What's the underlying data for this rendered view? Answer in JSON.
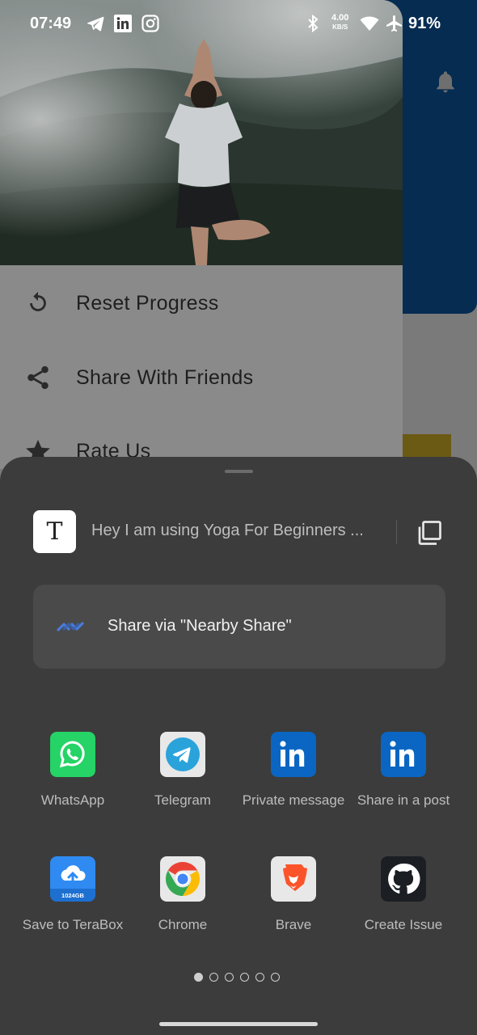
{
  "status_bar": {
    "time": "07:49",
    "net_speed_value": "4.00",
    "net_speed_unit": "KB/S",
    "battery": "91%",
    "icons": [
      "telegram-icon",
      "linkedin-icon",
      "instagram-icon",
      "bluetooth-icon",
      "wifi-icon",
      "airplane-icon"
    ]
  },
  "drawer": {
    "menu": [
      {
        "label": "Reset Progress",
        "icon": "reset-icon"
      },
      {
        "label": "Share With Friends",
        "icon": "share-icon"
      },
      {
        "label": "Rate Us",
        "icon": "star-icon"
      }
    ]
  },
  "share_sheet": {
    "preview_text": "Hey I am using Yoga For Beginners ...",
    "preview_thumb_letter": "T",
    "nearby_label": "Share via \"Nearby Share\"",
    "apps": [
      {
        "label": "WhatsApp",
        "icon": "whatsapp-icon",
        "color": "#25d366"
      },
      {
        "label": "Telegram",
        "icon": "telegram-icon",
        "color": "#2aa3db"
      },
      {
        "label": "Private message",
        "icon": "linkedin-icon",
        "color": "#0a66c2"
      },
      {
        "label": "Share in a post",
        "icon": "linkedin-icon",
        "color": "#0a66c2"
      },
      {
        "label": "Save to TeraBox",
        "icon": "terabox-icon",
        "color": "#2f8bf2"
      },
      {
        "label": "Chrome",
        "icon": "chrome-icon",
        "color": "#4285f4"
      },
      {
        "label": "Brave",
        "icon": "brave-icon",
        "color": "#fb542b"
      },
      {
        "label": "Create Issue",
        "icon": "github-icon",
        "color": "#1b1f24"
      }
    ],
    "terabox_badge": "1024GB",
    "page_count": 6,
    "active_page": 1
  }
}
